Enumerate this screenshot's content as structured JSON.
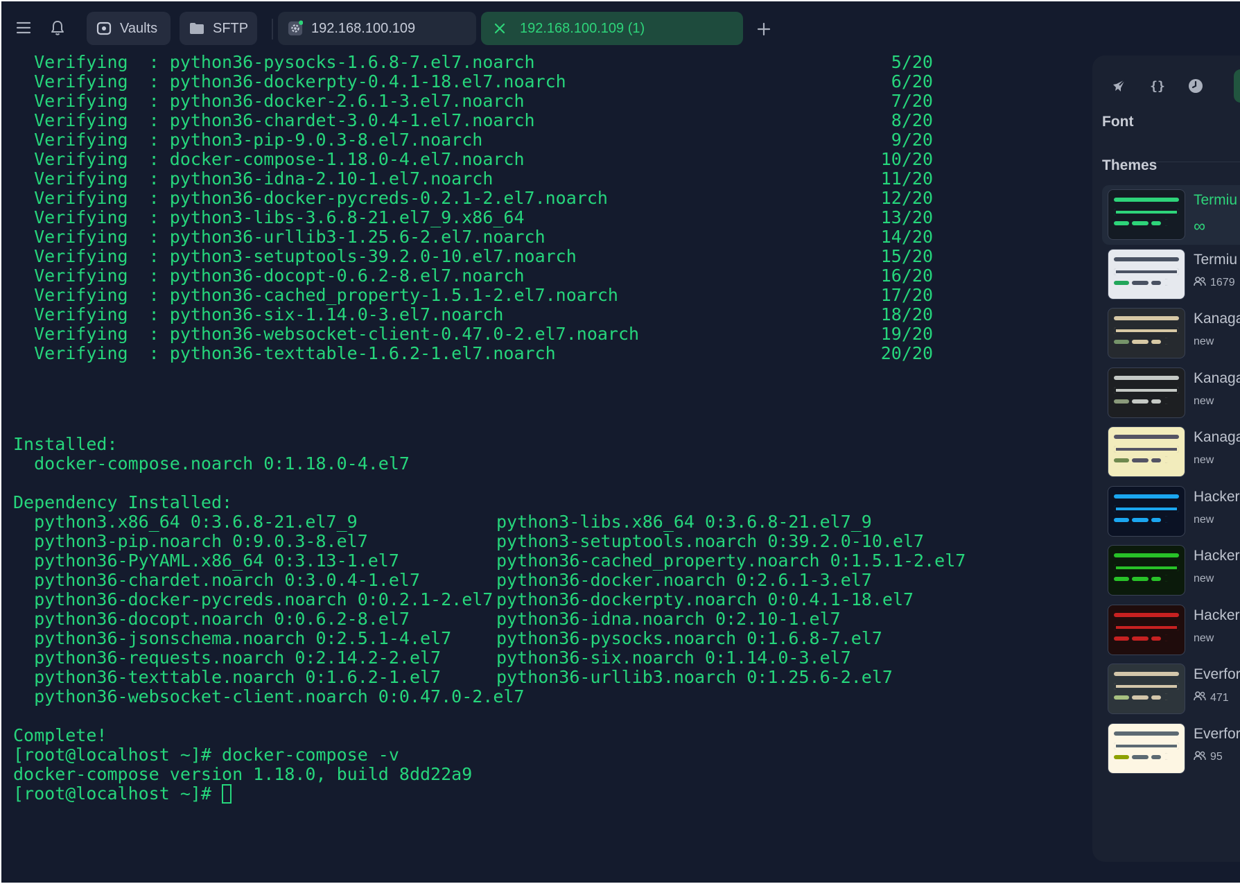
{
  "topbar": {
    "vaults_label": "Vaults",
    "sftp_label": "SFTP",
    "tabs": [
      {
        "label": "192.168.100.109"
      },
      {
        "label": "192.168.100.109 (1)"
      }
    ],
    "icons": [
      "menu-icon",
      "bell-icon",
      "vault-icon",
      "folder-icon",
      "gear-icon",
      "close-icon",
      "plus-icon"
    ],
    "accent": "#2ed47a"
  },
  "terminal": {
    "text_color": "#26d67c",
    "verify_prefix": "  Verifying  : ",
    "verifying": [
      {
        "pkg": "python36-pysocks-1.6.8-7.el7.noarch",
        "num": "5/20"
      },
      {
        "pkg": "python36-dockerpty-0.4.1-18.el7.noarch",
        "num": "6/20"
      },
      {
        "pkg": "python36-docker-2.6.1-3.el7.noarch",
        "num": "7/20"
      },
      {
        "pkg": "python36-chardet-3.0.4-1.el7.noarch",
        "num": "8/20"
      },
      {
        "pkg": "python3-pip-9.0.3-8.el7.noarch",
        "num": "9/20"
      },
      {
        "pkg": "docker-compose-1.18.0-4.el7.noarch",
        "num": "10/20"
      },
      {
        "pkg": "python36-idna-2.10-1.el7.noarch",
        "num": "11/20"
      },
      {
        "pkg": "python36-docker-pycreds-0.2.1-2.el7.noarch",
        "num": "12/20"
      },
      {
        "pkg": "python3-libs-3.6.8-21.el7_9.x86_64",
        "num": "13/20"
      },
      {
        "pkg": "python36-urllib3-1.25.6-2.el7.noarch",
        "num": "14/20"
      },
      {
        "pkg": "python3-setuptools-39.2.0-10.el7.noarch",
        "num": "15/20"
      },
      {
        "pkg": "python36-docopt-0.6.2-8.el7.noarch",
        "num": "16/20"
      },
      {
        "pkg": "python36-cached_property-1.5.1-2.el7.noarch",
        "num": "17/20"
      },
      {
        "pkg": "python36-six-1.14.0-3.el7.noarch",
        "num": "18/20"
      },
      {
        "pkg": "python36-websocket-client-0.47.0-2.el7.noarch",
        "num": "19/20"
      },
      {
        "pkg": "python36-texttable-1.6.2-1.el7.noarch",
        "num": "20/20"
      }
    ],
    "installed_header": "Installed:",
    "installed": [
      "  docker-compose.noarch 0:1.18.0-4.el7"
    ],
    "dep_header": "Dependency Installed:",
    "deps_left": [
      "  python3.x86_64 0:3.6.8-21.el7_9",
      "  python3-pip.noarch 0:9.0.3-8.el7",
      "  python36-PyYAML.x86_64 0:3.13-1.el7",
      "  python36-chardet.noarch 0:3.0.4-1.el7",
      "  python36-docker-pycreds.noarch 0:0.2.1-2.el7",
      "  python36-docopt.noarch 0:0.6.2-8.el7",
      "  python36-jsonschema.noarch 0:2.5.1-4.el7",
      "  python36-requests.noarch 0:2.14.2-2.el7",
      "  python36-texttable.noarch 0:1.6.2-1.el7",
      "  python36-websocket-client.noarch 0:0.47.0-2.el7"
    ],
    "deps_right": [
      "python3-libs.x86_64 0:3.6.8-21.el7_9",
      "python3-setuptools.noarch 0:39.2.0-10.el7",
      "python36-cached_property.noarch 0:1.5.1-2.el7",
      "python36-docker.noarch 0:2.6.1-3.el7",
      "python36-dockerpty.noarch 0:0.4.1-18.el7",
      "python36-idna.noarch 0:2.10-1.el7",
      "python36-pysocks.noarch 0:1.6.8-7.el7",
      "python36-six.noarch 0:1.14.0-3.el7",
      "python36-urllib3.noarch 0:1.25.6-2.el7"
    ],
    "complete": "Complete!",
    "cmd1": "[root@localhost ~]# docker-compose -v",
    "version_output": "docker-compose version 1.18.0, build 8dd22a9",
    "prompt": "[root@localhost ~]# "
  },
  "side_panel": {
    "icons": [
      "rocket-icon",
      "braces-icon",
      "clock-icon"
    ],
    "font_label": "Font",
    "themes_label": "Themes",
    "themes": [
      {
        "name": "Termiu",
        "meta": "∞",
        "meta_kind": "infinity",
        "active": true,
        "bg": "#141b24",
        "bars": [
          "#2ed47a",
          "#2ed47a",
          "#2ed47a"
        ]
      },
      {
        "name": "Termiu",
        "meta": "1679",
        "meta_kind": "users",
        "active": false,
        "bg": "#e6e9ee",
        "bars": [
          "#4a5262",
          "#4a5262",
          "#22a65a"
        ]
      },
      {
        "name": "Kanaga",
        "meta": "new",
        "meta_kind": "text",
        "active": false,
        "bg": "#262a2f",
        "bars": [
          "#d8c9a5",
          "#d8c9a5",
          "#76946a"
        ]
      },
      {
        "name": "Kanaga",
        "meta": "new",
        "meta_kind": "text",
        "active": false,
        "bg": "#1d1f22",
        "bars": [
          "#c5c9c5",
          "#c5c9c5",
          "#8a9a7b"
        ]
      },
      {
        "name": "Kanaga",
        "meta": "new",
        "meta_kind": "text",
        "active": false,
        "bg": "#f2ecbc",
        "bars": [
          "#545464",
          "#545464",
          "#6f894e"
        ]
      },
      {
        "name": "Hacker",
        "meta": "new",
        "meta_kind": "text",
        "active": false,
        "bg": "#0b1224",
        "bars": [
          "#1ba6f0",
          "#1ba6f0",
          "#1ba6f0"
        ]
      },
      {
        "name": "Hacker",
        "meta": "new",
        "meta_kind": "text",
        "active": false,
        "bg": "#0b1a0b",
        "bars": [
          "#28c228",
          "#28c228",
          "#28c228"
        ]
      },
      {
        "name": "Hacker",
        "meta": "new",
        "meta_kind": "text",
        "active": false,
        "bg": "#1f0c0c",
        "bars": [
          "#c72121",
          "#c72121",
          "#c72121"
        ]
      },
      {
        "name": "Everfor",
        "meta": "471",
        "meta_kind": "users",
        "active": false,
        "bg": "#2d353b",
        "bars": [
          "#d3c6aa",
          "#d3c6aa",
          "#a7c080"
        ]
      },
      {
        "name": "Everfor",
        "meta": "95",
        "meta_kind": "users",
        "active": false,
        "bg": "#fdf6e3",
        "bars": [
          "#5c6a72",
          "#5c6a72",
          "#8da101"
        ]
      }
    ]
  }
}
